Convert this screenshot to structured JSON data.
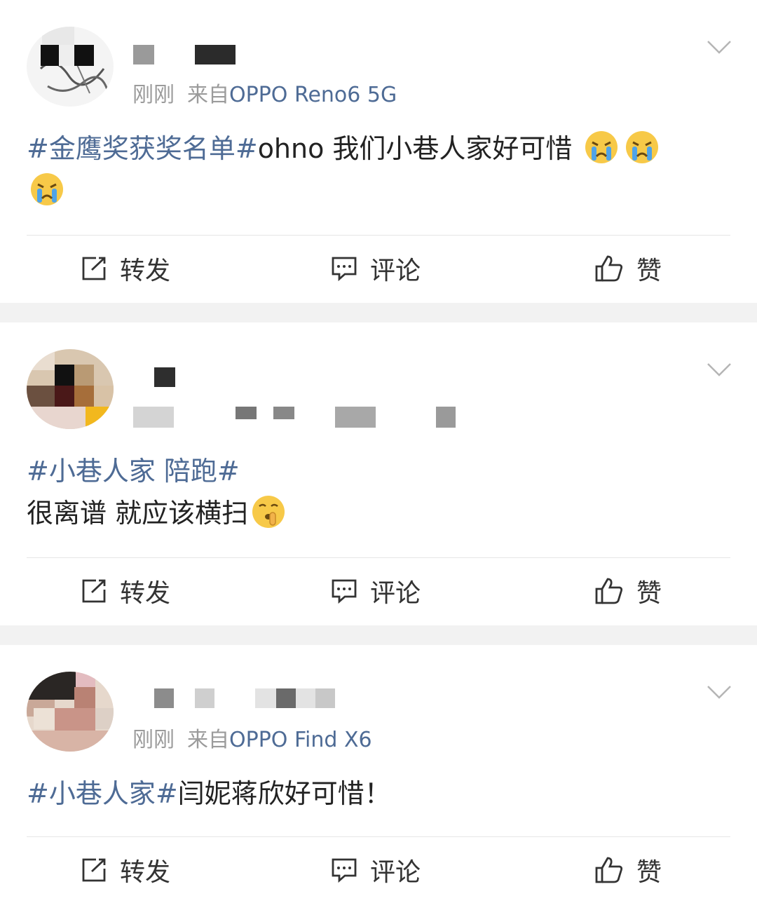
{
  "posts": [
    {
      "time": "刚刚",
      "source_prefix": "来自",
      "device": "OPPO Reno6 5G",
      "tag1": "#金鹰奖获奖名单#",
      "text1": "ohno 我们小巷人家好可惜",
      "emojis": [
        "crying-face",
        "crying-face",
        "crying-face"
      ],
      "actions": {
        "repost": "转发",
        "comment": "评论",
        "like": "赞"
      }
    },
    {
      "tag1": "#小巷人家 陪跑#",
      "text1": "很离谱 就应该横扫",
      "emojis": [
        "shushing-face"
      ],
      "actions": {
        "repost": "转发",
        "comment": "评论",
        "like": "赞"
      }
    },
    {
      "time": "刚刚",
      "source_prefix": "来自",
      "device": "OPPO Find X6",
      "tag1": "#小巷人家#",
      "text1": "闫妮蒋欣好可惜！",
      "actions": {
        "repost": "转发",
        "comment": "评论",
        "like": "赞"
      }
    }
  ],
  "colors": {
    "link": "#4e6b95",
    "meta": "#9b9b9b",
    "separator": "#f2f2f2"
  }
}
